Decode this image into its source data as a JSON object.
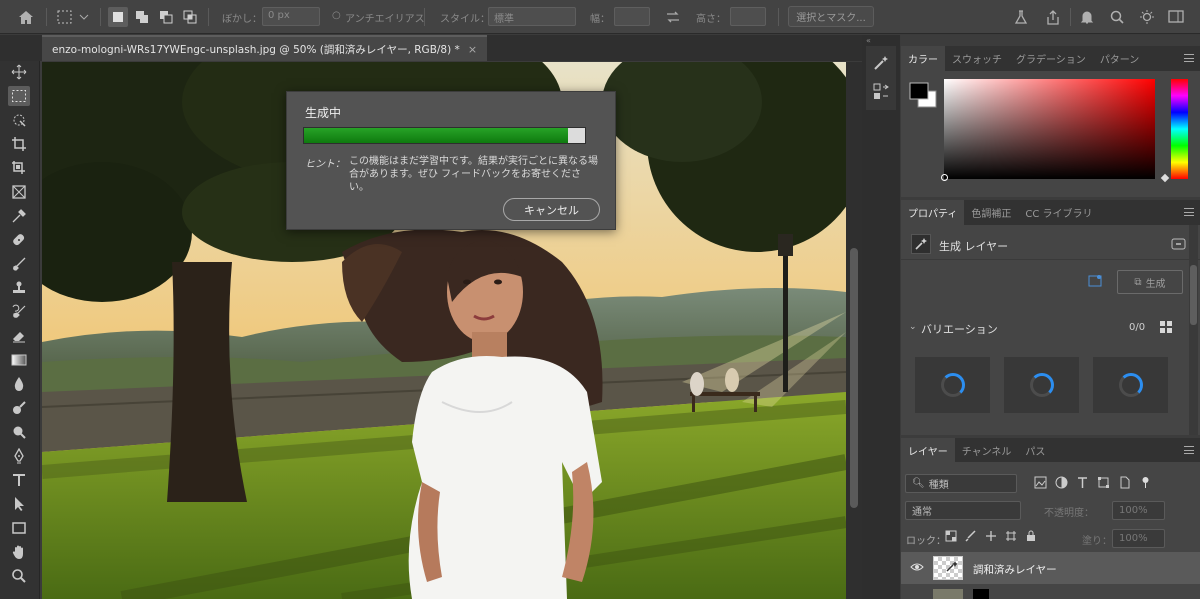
{
  "options_bar": {
    "feather_label": "ぼかし：",
    "feather_value": "0 px",
    "antialias_label": "アンチエイリアス",
    "style_label": "スタイル：",
    "style_value": "標準",
    "width_label": "幅：",
    "height_label": "高さ：",
    "select_mask_button": "選択とマスク..."
  },
  "document_tab": {
    "title": "enzo-mologni-WRs17YWEngc-unsplash.jpg @ 50% (調和済みレイヤー, RGB/8) *",
    "close": "×"
  },
  "dialog": {
    "title": "生成中",
    "progress": 0.94,
    "hint_label": "ヒント：",
    "hint_text": "この機能はまだ学習中です。結果が実行ごとに異なる場合があります。ぜひ フィードバックをお寄せください。",
    "cancel_button": "キャンセル"
  },
  "color_panel": {
    "tabs": [
      "カラー",
      "スウォッチ",
      "グラデーション",
      "パターン"
    ],
    "foreground": "#000000",
    "background": "#ffffff",
    "hue_color": "#ff0000"
  },
  "properties_panel": {
    "tabs": [
      "プロパティ",
      "色調補正",
      "CC ライブラリ"
    ],
    "layer_type": "生成 レイヤー",
    "generate_button": "生成",
    "variations_label": "バリエーション",
    "variations_count": "0/0"
  },
  "layers_panel": {
    "tabs": [
      "レイヤー",
      "チャンネル",
      "パス"
    ],
    "filter_kind": "種類",
    "blend_mode": "通常",
    "opacity_label": "不透明度：",
    "opacity_value": "100%",
    "lock_label": "ロック：",
    "fill_label": "塗り：",
    "fill_value": "100%",
    "layers": [
      {
        "name": "調和済みレイヤー"
      }
    ]
  },
  "colors": {
    "accent_blue": "#2c8ef0",
    "progress_green": "#1c9a1c"
  }
}
